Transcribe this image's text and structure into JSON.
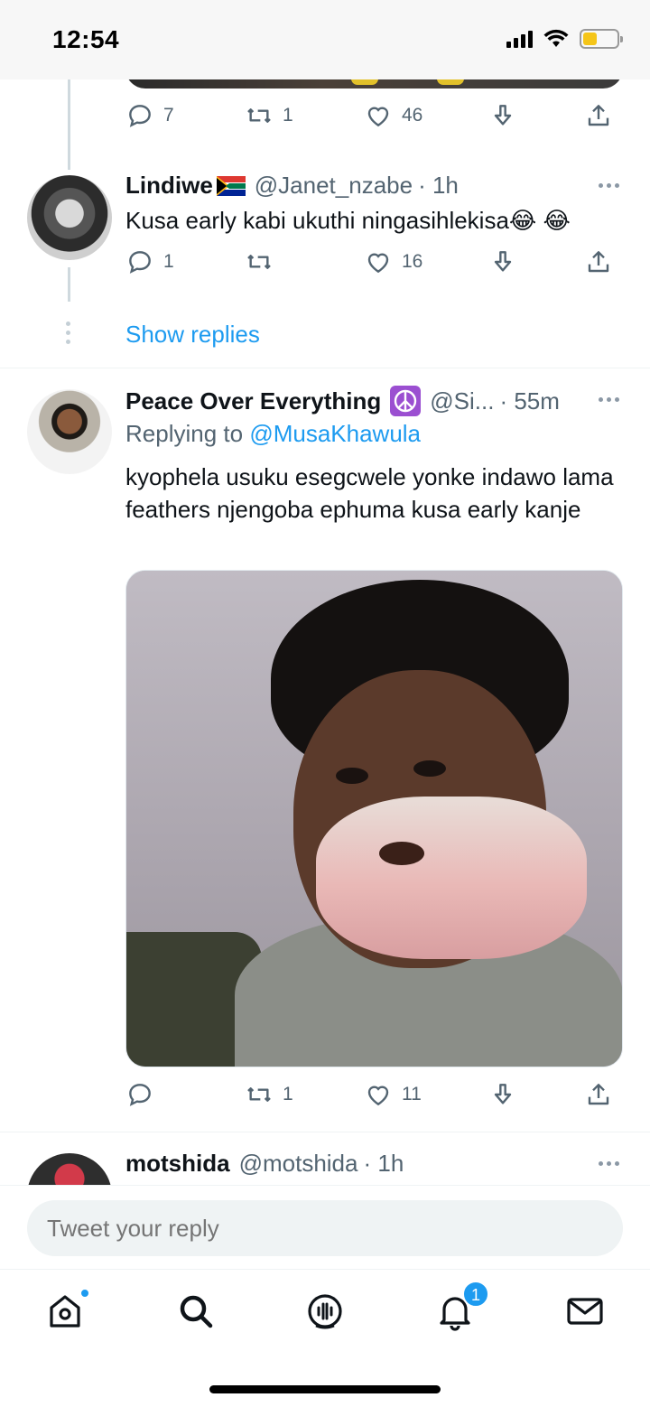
{
  "status_bar": {
    "time": "12:54"
  },
  "thread_prev": {
    "actions": {
      "replies": "7",
      "retweets": "1",
      "likes": "46"
    }
  },
  "tweet_lindiwe": {
    "name": "Lindiwe",
    "handle": "@Janet_nzabe",
    "time": "· 1h",
    "text": "Kusa early kabi ukuthi ningasihlekisa😂 😂",
    "actions": {
      "replies": "1",
      "retweets": "",
      "likes": "16"
    }
  },
  "show_replies_label": "Show replies",
  "tweet_peace": {
    "name": "Peace Over Everything",
    "handle": "@Si...",
    "time": "· 55m",
    "replying_to_label": "Replying to",
    "replying_to_mention": "@MusaKhawula",
    "text": "kyophela usuku esegcwele yonke indawo lama feathers njengoba ephuma kusa early kanje",
    "actions": {
      "replies": "",
      "retweets": "1",
      "likes": "11"
    }
  },
  "tweet_motshida": {
    "name": "motshida",
    "handle": "@motshida",
    "time": "· 1h"
  },
  "reply_box": {
    "placeholder": "Tweet your reply"
  },
  "tab_bar": {
    "notifications_badge": "1"
  },
  "colors": {
    "accent": "#1d9bf0",
    "muted": "#536471",
    "text": "#0f1419"
  }
}
